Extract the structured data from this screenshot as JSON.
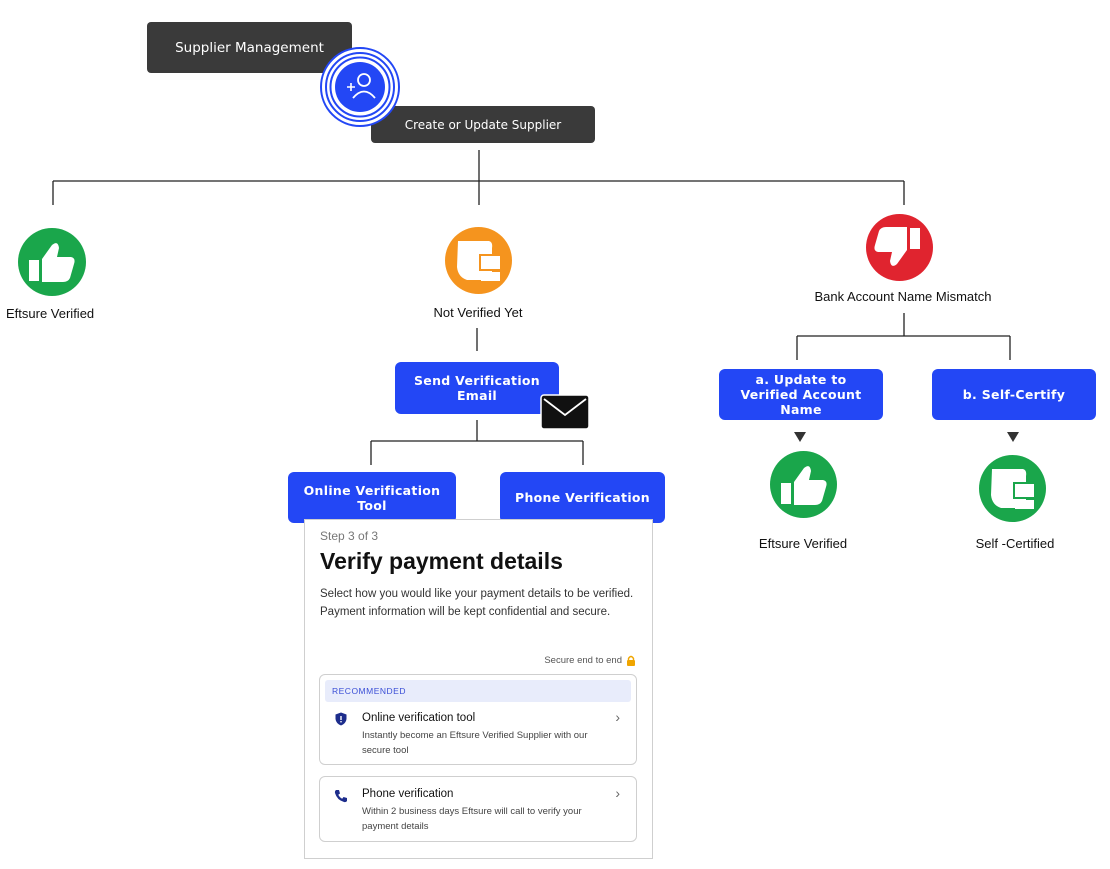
{
  "nodes": {
    "supplier_management": "Supplier Management",
    "create_update": "Create or Update Supplier",
    "eftsure_verified_left": "Eftsure Verified",
    "not_verified": "Not Verified Yet",
    "mismatch": "Bank Account Name Mismatch",
    "send_email": "Send Verification Email",
    "online_tool": "Online Verification Tool",
    "phone": "Phone Verification",
    "update_verified": "a. Update to Verified Account Name",
    "self_certify": "b. Self-Certify",
    "eftsure_verified_right": "Eftsure Verified",
    "self_certified": "Self -Certified"
  },
  "icons": {
    "person_plus": "add-user-icon",
    "thumbs_up": "thumbs-up-icon",
    "thumbs_sideways": "thumb-sideways-icon",
    "thumbs_down": "thumbs-down-icon",
    "envelope": "envelope-icon",
    "shield": "shield-icon",
    "phone": "phone-icon",
    "lock": "lock-icon"
  },
  "colors": {
    "dark": "#3a3a3a",
    "blue": "#2347f5",
    "green": "#1aa64b",
    "orange": "#f5941e",
    "red": "#e0242f"
  },
  "panel": {
    "step": "Step 3 of 3",
    "title": "Verify payment details",
    "description": "Select how you would like your payment details to be verified. Payment information will be kept confidential and secure.",
    "secure": "Secure end to end",
    "recommended": "RECOMMENDED",
    "option1_title": "Online verification tool",
    "option1_sub": "Instantly become an Eftsure Verified Supplier with our secure tool",
    "option2_title": "Phone verification",
    "option2_sub": "Within 2 business days Eftsure will call to verify your payment details"
  }
}
